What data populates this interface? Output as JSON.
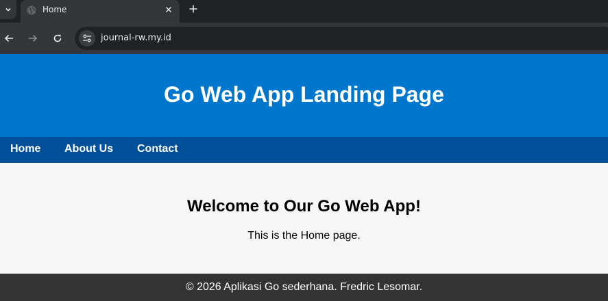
{
  "browser": {
    "tab_title": "Home",
    "url": "journal-rw.my.id",
    "icons": {
      "tab_list": "chevron-down-icon",
      "favicon": "globe-icon",
      "close": "close-icon",
      "new_tab": "plus-icon",
      "back": "back-arrow-icon",
      "forward": "forward-arrow-icon",
      "reload": "reload-icon",
      "site_info": "tune-icon"
    }
  },
  "header": {
    "title": "Go Web App Landing Page"
  },
  "nav": {
    "items": [
      {
        "label": "Home"
      },
      {
        "label": "About Us"
      },
      {
        "label": "Contact"
      }
    ]
  },
  "main": {
    "heading": "Welcome to Our Go Web App!",
    "text": "This is the Home page."
  },
  "footer": {
    "text": "© 2026 Aplikasi Go sederhana. Fredric Lesomar."
  },
  "colors": {
    "header_bg": "#0077cc",
    "nav_bg": "#005099",
    "footer_bg": "#333333",
    "main_bg": "#f6f6f6"
  }
}
